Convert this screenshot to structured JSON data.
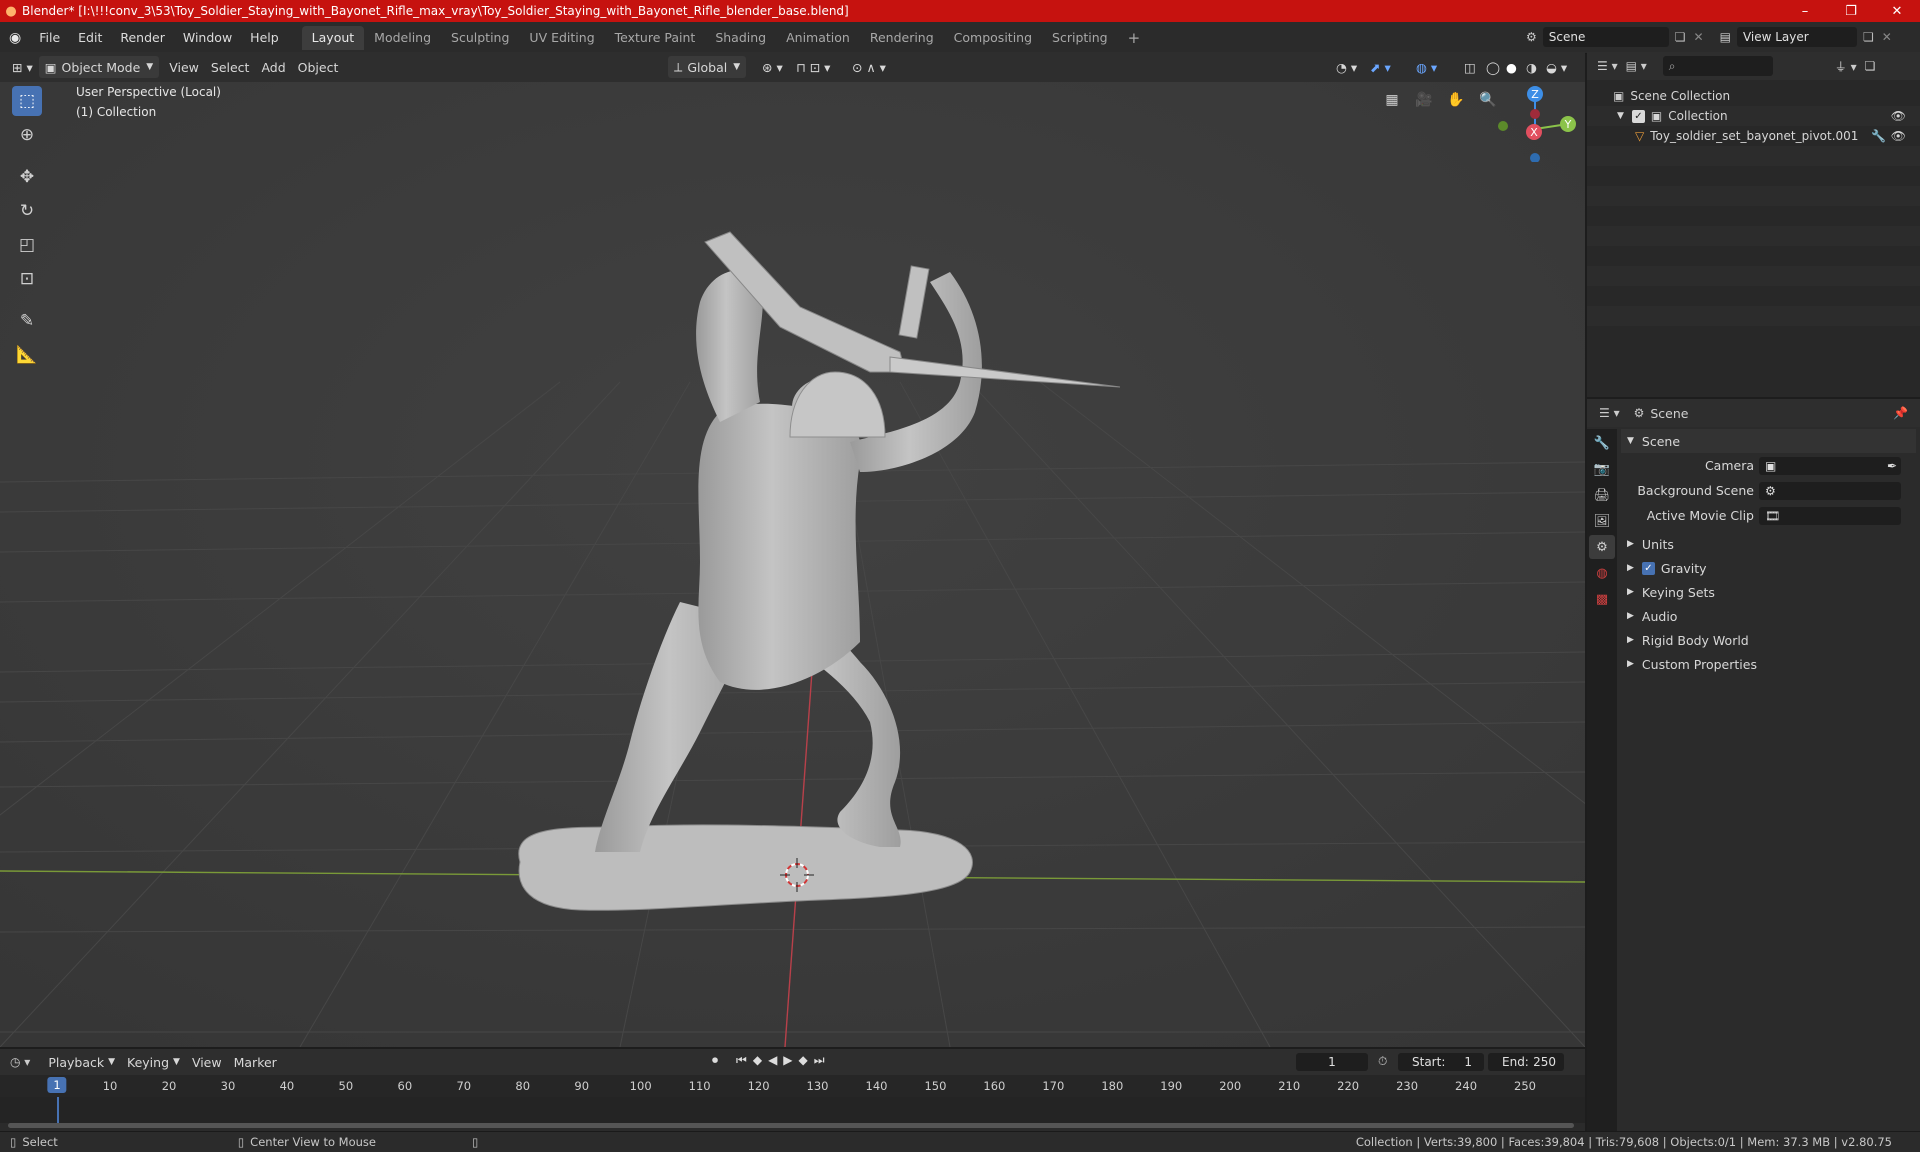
{
  "window": {
    "title": "Blender* [I:\\!!!conv_3\\53\\Toy_Soldier_Staying_with_Bayonet_Rifle_max_vray\\Toy_Soldier_Staying_with_Bayonet_Rifle_blender_base.blend]",
    "minimize": "–",
    "restore": "❐",
    "close": "✕"
  },
  "menu": [
    "File",
    "Edit",
    "Render",
    "Window",
    "Help"
  ],
  "workspaces": [
    "Layout",
    "Modeling",
    "Sculpting",
    "UV Editing",
    "Texture Paint",
    "Shading",
    "Animation",
    "Rendering",
    "Compositing",
    "Scripting"
  ],
  "active_workspace": "Layout",
  "scene_field": "Scene",
  "view_layer_field": "View Layer",
  "viewport_header": {
    "mode": "Object Mode",
    "view": "View",
    "select": "Select",
    "add": "Add",
    "object": "Object",
    "orientation": "Global"
  },
  "viewport": {
    "perspective_label": "User Perspective (Local)",
    "collection_label": "(1) Collection",
    "gizmo": {
      "z": "Z",
      "y": "Y",
      "x": "X"
    }
  },
  "outliner": {
    "search_placeholder": "",
    "scene_collection": "Scene Collection",
    "collection": "Collection",
    "object": "Toy_soldier_set_bayonet_pivot.001"
  },
  "properties": {
    "header_title": "Scene",
    "section": "Scene",
    "camera_label": "Camera",
    "background_scene_label": "Background Scene",
    "active_movie_clip_label": "Active Movie Clip",
    "panels": [
      "Units",
      "Gravity",
      "Keying Sets",
      "Audio",
      "Rigid Body World",
      "Custom Properties"
    ],
    "gravity_checked": true
  },
  "timeline": {
    "playback": "Playback",
    "keying": "Keying",
    "view": "View",
    "marker": "Marker",
    "current_frame": "1",
    "start_label": "Start:",
    "start_value": "1",
    "end_label": "End:",
    "end_value": "250",
    "ruler": [
      "1",
      "10",
      "20",
      "30",
      "40",
      "50",
      "60",
      "70",
      "80",
      "90",
      "100",
      "110",
      "120",
      "130",
      "140",
      "150",
      "160",
      "170",
      "180",
      "190",
      "200",
      "210",
      "220",
      "230",
      "240",
      "250"
    ]
  },
  "statusbar": {
    "select": "Select",
    "center_view": "Center View to Mouse",
    "stats": "Collection | Verts:39,800 | Faces:39,804 | Tris:79,608 | Objects:0/1 | Mem: 37.3 MB | v2.80.75"
  },
  "colors": {
    "title_bar": "#c6120f",
    "accent": "#4772b3",
    "x_axis": "#e14f5f",
    "y_axis": "#8bc34a",
    "z_axis": "#3d8ee6"
  }
}
